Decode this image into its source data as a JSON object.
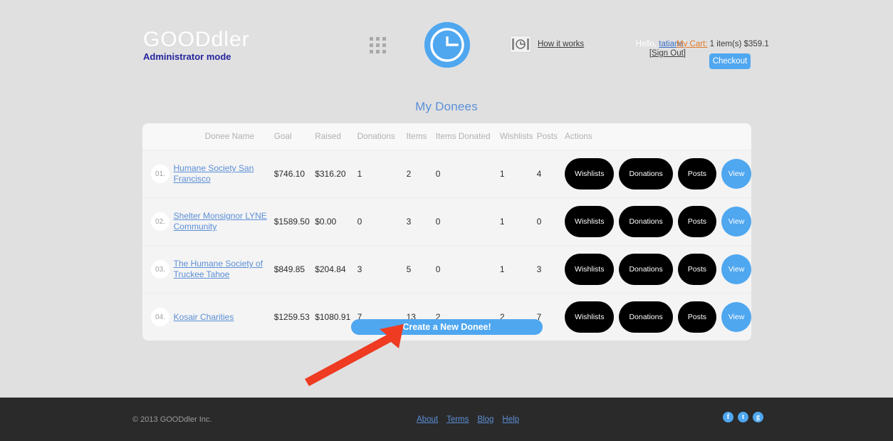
{
  "header": {
    "brand_name": "GOODdler",
    "admin_mode": "Administrator mode",
    "apps_icon": "apps-grid-icon",
    "logo_icon": "gooddler-logo-icon",
    "howitworks_icon": "video-frame-icon",
    "howitworks_label": "How it works",
    "hello_prefix": "Hello, ",
    "username": "tatiana",
    "hello_suffix": "!",
    "sign_out": "[Sign Out]",
    "cart_label": "My Cart:",
    "cart_value": " 1 item(s) $359.1",
    "checkout_label": "Checkout"
  },
  "main": {
    "page_title": "My Donees",
    "create_button": "Create a New Donee!",
    "columns": [
      "",
      "Donee Name",
      "Goal",
      "Raised",
      "Donations",
      "Items",
      "Items Donated",
      "Wishlists",
      "Posts",
      "Actions"
    ],
    "action_labels": {
      "wishlists": "Wishlists",
      "donations": "Donations",
      "posts": "Posts",
      "view": "View"
    },
    "rows": [
      {
        "num": "01.",
        "name": "Humane Society San Francisco",
        "goal": "$746.10",
        "raised": "$316.20",
        "donations": "1",
        "items": "2",
        "items_donated": "0",
        "wishlists": "1",
        "posts": "4"
      },
      {
        "num": "02.",
        "name": "Shelter Monsignor LYNE Community",
        "goal": "$1589.50",
        "raised": "$0.00",
        "donations": "0",
        "items": "3",
        "items_donated": "0",
        "wishlists": "1",
        "posts": "0"
      },
      {
        "num": "03.",
        "name": "The Humane Society of Truckee Tahoe",
        "goal": "$849.85",
        "raised": "$204.84",
        "donations": "3",
        "items": "5",
        "items_donated": "0",
        "wishlists": "1",
        "posts": "3"
      },
      {
        "num": "04.",
        "name": "Kosair Charities",
        "goal": "$1259.53",
        "raised": "$1080.91",
        "donations": "7",
        "items": "13",
        "items_donated": "2",
        "wishlists": "2",
        "posts": "7"
      }
    ]
  },
  "annotation": {
    "arrow_icon": "red-arrow-pointer",
    "arrow_color": "#ee3b22"
  },
  "footer": {
    "copyright": "© 2013 GOODdler Inc.",
    "links": [
      "About",
      "Terms",
      "Blog",
      "Help"
    ],
    "social": [
      {
        "icon": "facebook-icon",
        "glyph": "f"
      },
      {
        "icon": "twitter-icon",
        "glyph": "t"
      },
      {
        "icon": "google-plus-icon",
        "glyph": "g"
      }
    ]
  },
  "colors": {
    "page_bg": "#e0e0e1",
    "panel_bg": "#f4f4f4",
    "accent_blue": "#4fa7f0",
    "link_blue": "#5b8fd6",
    "admin_blue": "#25239c",
    "cart_orange": "#e07b2a",
    "footer_bg": "#2a2a2a",
    "pill_black": "#000000"
  }
}
